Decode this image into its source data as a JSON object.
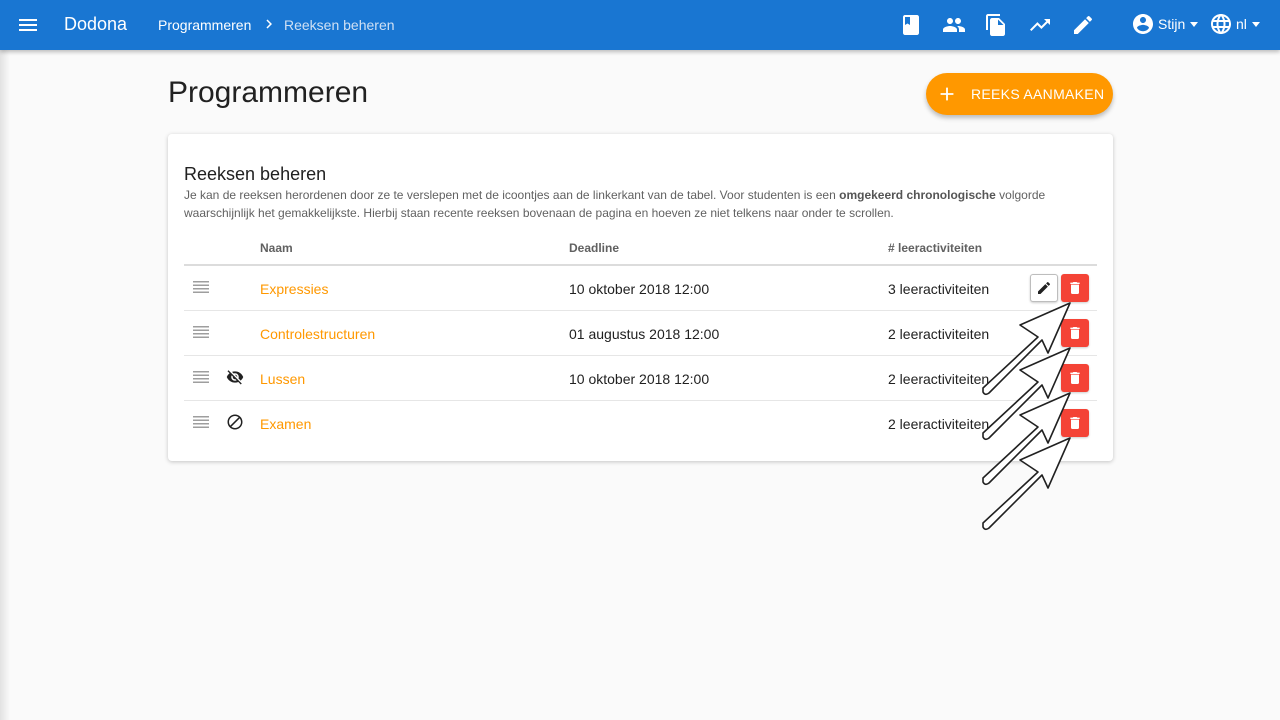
{
  "navbar": {
    "brand": "Dodona",
    "breadcrumb": [
      "Programmeren",
      "Reeksen beheren"
    ],
    "icons": [
      "menu-icon",
      "book-icon",
      "users-icon",
      "document-icon",
      "trending-up-icon",
      "pencil-icon"
    ],
    "user_name": "Stijn",
    "language": "nl"
  },
  "page": {
    "title": "Programmeren",
    "create_button": "REEKS AANMAKEN"
  },
  "card": {
    "title": "Reeksen beheren",
    "description_pre": "Je kan de reeksen herordenen door ze te verslepen met de icoontjes aan de linkerkant van de tabel. Voor studenten is een ",
    "description_bold": "omgekeerd chronologische",
    "description_post": " volgorde waarschijnlijk het gemakkelijkste. Hierbij staan recente reeksen bovenaan de pagina en hoeven ze niet telkens naar onder te scrollen."
  },
  "table": {
    "headers": [
      "Naam",
      "Deadline",
      "# leeractiviteiten"
    ],
    "rows": [
      {
        "name": "Expressies",
        "deadline": "10 oktober 2018 12:00",
        "count": "3 leeractiviteiten",
        "status_icon": ""
      },
      {
        "name": "Controlestructuren",
        "deadline": "01 augustus 2018 12:00",
        "count": "2 leeractiviteiten",
        "status_icon": ""
      },
      {
        "name": "Lussen",
        "deadline": "10 oktober 2018 12:00",
        "count": "2 leeractiviteiten",
        "status_icon": "eye-off-icon"
      },
      {
        "name": "Examen",
        "deadline": "",
        "count": "2 leeractiviteiten",
        "status_icon": "block-icon"
      }
    ]
  },
  "colors": {
    "primary": "#1976d2",
    "accent": "#ff9800",
    "danger": "#f44336"
  }
}
